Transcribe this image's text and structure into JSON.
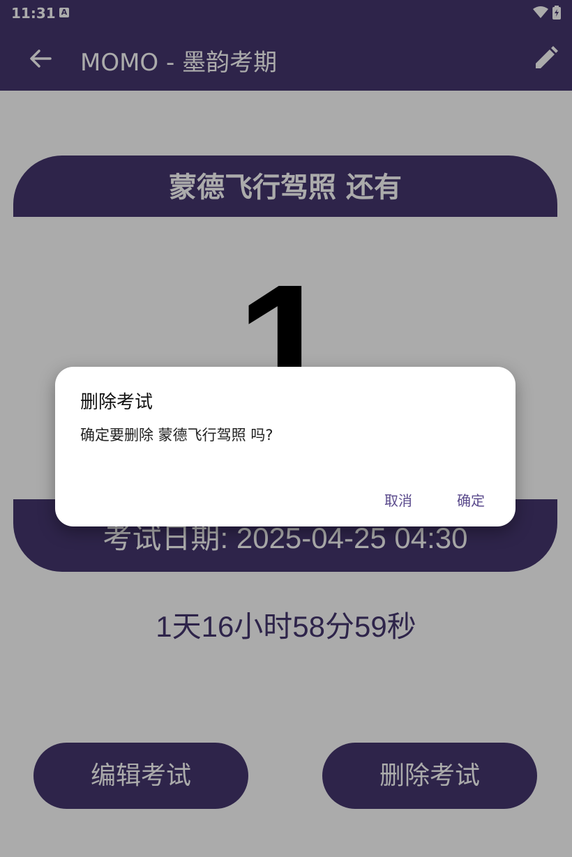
{
  "status_bar": {
    "time": "11:31",
    "a_badge": "A"
  },
  "app_bar": {
    "title": "MOMO - 墨韵考期",
    "back_icon": "arrow-back-icon",
    "edit_icon": "pencil-icon"
  },
  "card": {
    "header": "蒙德飞行驾照 还有",
    "days": "1",
    "footer": "考试日期: 2025-04-25 04:30"
  },
  "countdown": "1天16小时58分59秒",
  "buttons": {
    "edit": "编辑考试",
    "delete": "删除考试"
  },
  "dialog": {
    "title": "删除考试",
    "message": "确定要删除 蒙德飞行驾照 吗?",
    "cancel": "取消",
    "confirm": "确定"
  },
  "colors": {
    "primary": "#45366f",
    "dialog_button": "#5a4a8c"
  }
}
